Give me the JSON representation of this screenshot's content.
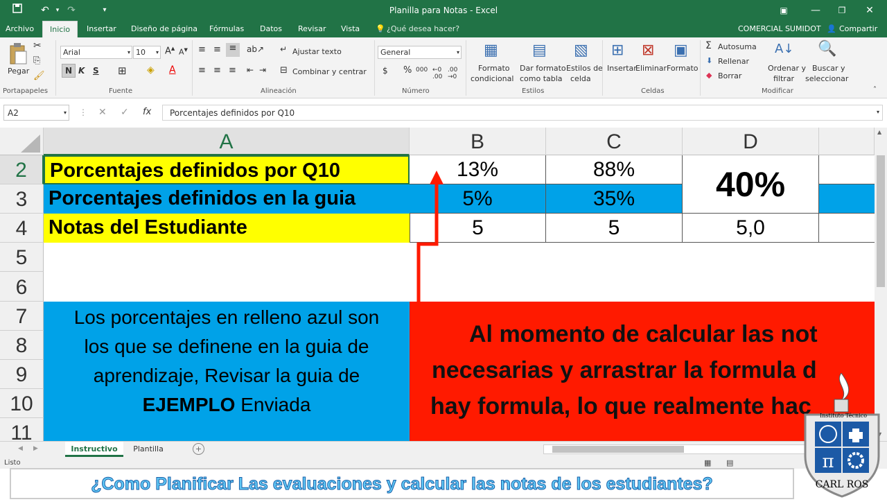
{
  "window": {
    "title": "Planilla para Notas - Excel"
  },
  "menu": {
    "archivo": "Archivo",
    "inicio": "Inicio",
    "insertar": "Insertar",
    "diseno": "Diseño de página",
    "formulas": "Fórmulas",
    "datos": "Datos",
    "revisar": "Revisar",
    "vista": "Vista",
    "tell": "¿Qué desea hacer?",
    "account": "COMERCIAL SUMIDOT",
    "share": "Compartir"
  },
  "ribbon": {
    "paste": "Pegar",
    "font_name": "Arial",
    "font_size": "10",
    "bold": "N",
    "italic": "K",
    "underline": "S",
    "wrap": "Ajustar texto",
    "merge": "Combinar y centrar",
    "number_format": "General",
    "currency": "$",
    "percent": "%",
    "thousands": "000",
    "cond_format_1": "Formato",
    "cond_format_2": "condicional",
    "table_format_1": "Dar formato",
    "table_format_2": "como tabla",
    "cell_styles_1": "Estilos de",
    "cell_styles_2": "celda",
    "insert": "Insertar",
    "delete": "Eliminar",
    "format": "Formato",
    "autosum": "Autosuma",
    "fill": "Rellenar",
    "clear": "Borrar",
    "sort_1": "Ordenar y",
    "sort_2": "filtrar",
    "find_1": "Buscar y",
    "find_2": "seleccionar",
    "groups": {
      "clipboard": "Portapapeles",
      "font": "Fuente",
      "alignment": "Alineación",
      "number": "Número",
      "styles": "Estilos",
      "cells": "Celdas",
      "editing": "Modificar"
    }
  },
  "formula": {
    "name_box": "A2",
    "fx": "fx",
    "content": "Porcentajes definidos por Q10"
  },
  "grid": {
    "col_headers": [
      "A",
      "B",
      "C",
      "D"
    ],
    "row_headers": [
      "2",
      "3",
      "4",
      "5",
      "6",
      "7",
      "8",
      "9",
      "10",
      "11"
    ],
    "a2": "Porcentajes definidos por Q10",
    "a3": "Porcentajes definidos en la guia",
    "a4": "Notas del Estudiante",
    "b2": "13%",
    "c2": "88%",
    "d23": "40%",
    "b3": "5%",
    "c3": "35%",
    "b4": "5",
    "c4": "5",
    "d4": "5,0",
    "note_line1": "Los porcentajes en relleno azul son",
    "note_line2": "los que se definene en la guia de",
    "note_line3": "aprendizaje, Revisar la guia de",
    "note_bold": "EJEMPLO",
    "note_rest": " Enviada",
    "red_line1": "Al momento de calcular las not",
    "red_line2": "necesarias y arrastrar la formula d",
    "red_line3": "hay formula, lo que realmente hac"
  },
  "sheets": {
    "tab1": "Instructivo",
    "tab2": "Plantilla"
  },
  "status": {
    "ready": "Listo"
  },
  "logo": {
    "top_text": "Instituto Técnico",
    "bottom_text": "CARL ROS"
  },
  "banner": {
    "text": "¿Como Planificar Las evaluaciones y calcular las notas de los estudiantes?"
  },
  "colors": {
    "excel_green": "#217346",
    "yellow": "#ffff00",
    "blue": "#00a2e8",
    "red": "#ff1a00"
  }
}
